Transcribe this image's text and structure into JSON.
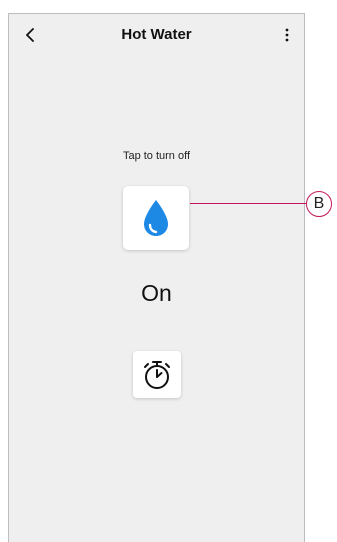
{
  "header": {
    "title": "Hot Water",
    "back_icon": "chevron-left-icon",
    "menu_icon": "more-vertical-icon"
  },
  "main": {
    "hint": "Tap to turn off",
    "water_icon": "water-drop-icon",
    "state": "On",
    "timer_icon": "stopwatch-icon"
  },
  "annotation": {
    "label": "B",
    "color": "#c2185b"
  },
  "colors": {
    "accent": "#1e88e5",
    "background": "#efefef"
  }
}
